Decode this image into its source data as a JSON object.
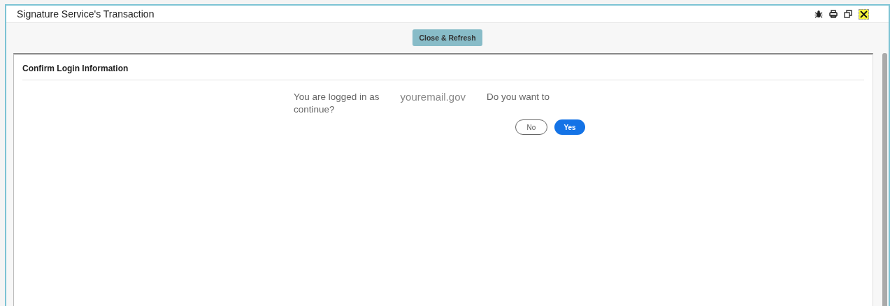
{
  "window": {
    "title": "Signature Service's Transaction"
  },
  "toolbar": {
    "button": "Close & Refresh"
  },
  "panel": {
    "title": "Confirm Login Information",
    "message": {
      "prefix": "You are logged in as",
      "email": "youremail.gov",
      "suffix": "Do you want to",
      "continuation": "continue?"
    },
    "buttons": [
      {
        "label": "No",
        "kind": "secondary"
      },
      {
        "label": "Yes",
        "kind": "primary"
      }
    ]
  }
}
